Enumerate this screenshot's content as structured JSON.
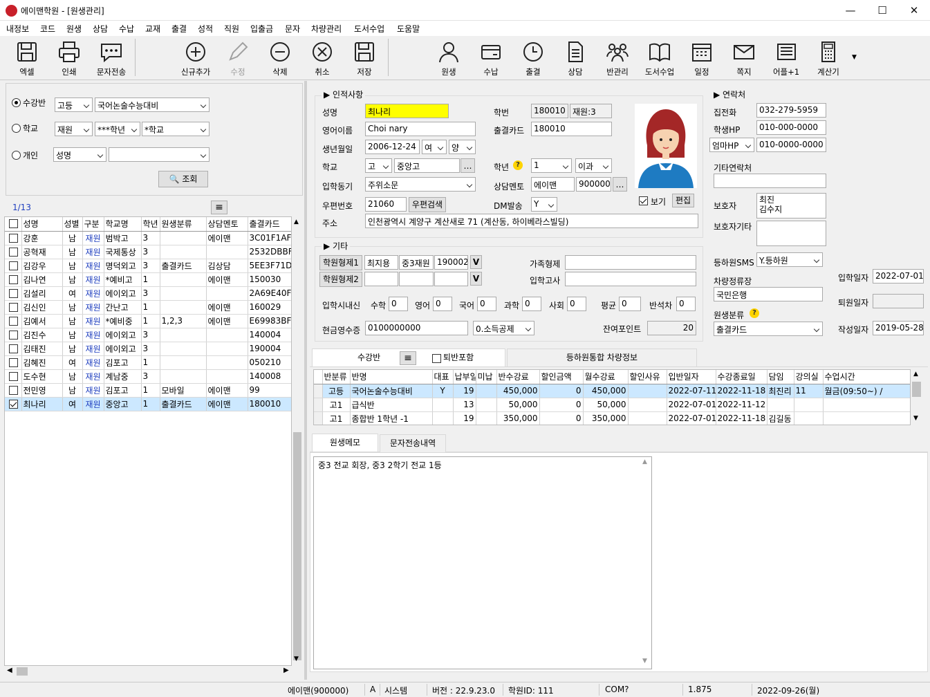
{
  "window": {
    "title": "에이맨학원 - [원생관리]"
  },
  "menu": [
    "내정보",
    "코드",
    "원생",
    "상담",
    "수납",
    "교재",
    "출결",
    "성적",
    "직원",
    "입출금",
    "문자",
    "차량관리",
    "도서수업",
    "도움말"
  ],
  "toolbar": {
    "excel": "엑셀",
    "print": "인쇄",
    "sms": "문자전송",
    "add": "신규추가",
    "edit": "수정",
    "delete": "삭제",
    "cancel": "취소",
    "save": "저장",
    "student": "원생",
    "payment": "수납",
    "attendance": "출결",
    "consult": "상담",
    "class_mgmt": "반관리",
    "book_class": "도서수업",
    "schedule": "일정",
    "note": "쪽지",
    "more": "어플+1",
    "calculator": "계산기"
  },
  "search": {
    "radio_class": "수강반",
    "radio_school": "학교",
    "radio_person": "개인",
    "class_level": "고등",
    "class_name": "국어논술수능대비",
    "school_status": "재원",
    "school_grade": "***학년",
    "school_name": "*학교",
    "person_field": "성명",
    "person_value": "",
    "search_btn": "조회"
  },
  "list": {
    "count": "1/13",
    "headers": [
      "성명",
      "성별",
      "구분",
      "학교명",
      "학년",
      "원생분류",
      "상담멘토",
      "출결카드"
    ],
    "rows": [
      {
        "checked": false,
        "name": "강훈",
        "gender": "남",
        "type": "재원",
        "school": "범박고",
        "grade": "3",
        "category": "",
        "mentor": "에이맨",
        "card": "3C01F1AF"
      },
      {
        "checked": false,
        "name": "공혁재",
        "gender": "남",
        "type": "재원",
        "school": "국제통상",
        "grade": "3",
        "category": "",
        "mentor": "",
        "card": "2532DBBF"
      },
      {
        "checked": false,
        "name": "김강우",
        "gender": "남",
        "type": "재원",
        "school": "명덕외고",
        "grade": "3",
        "category": "출결카드",
        "mentor": "김상담",
        "card": "5EE3F71D"
      },
      {
        "checked": false,
        "name": "김나연",
        "gender": "남",
        "type": "재원",
        "school": "*예비고",
        "grade": "1",
        "category": "",
        "mentor": "에이맨",
        "card": "150030"
      },
      {
        "checked": false,
        "name": "김설리",
        "gender": "여",
        "type": "재원",
        "school": "에이외고",
        "grade": "3",
        "category": "",
        "mentor": "",
        "card": "2A69E40F"
      },
      {
        "checked": false,
        "name": "김신인",
        "gender": "남",
        "type": "재원",
        "school": "간난고",
        "grade": "1",
        "category": "",
        "mentor": "에이맨",
        "card": "160029"
      },
      {
        "checked": false,
        "name": "김예서",
        "gender": "남",
        "type": "재원",
        "school": "*예비중",
        "grade": "1",
        "category": "1,2,3",
        "mentor": "에이맨",
        "card": "E69983BF"
      },
      {
        "checked": false,
        "name": "김진수",
        "gender": "남",
        "type": "재원",
        "school": "에이외고",
        "grade": "3",
        "category": "",
        "mentor": "",
        "card": "140004"
      },
      {
        "checked": false,
        "name": "김태진",
        "gender": "남",
        "type": "재원",
        "school": "에이외고",
        "grade": "3",
        "category": "",
        "mentor": "",
        "card": "190004"
      },
      {
        "checked": false,
        "name": "김혜진",
        "gender": "여",
        "type": "재원",
        "school": "김포고",
        "grade": "1",
        "category": "",
        "mentor": "",
        "card": "050210"
      },
      {
        "checked": false,
        "name": "도수현",
        "gender": "남",
        "type": "재원",
        "school": "계남중",
        "grade": "3",
        "category": "",
        "mentor": "",
        "card": "140008"
      },
      {
        "checked": false,
        "name": "전민영",
        "gender": "남",
        "type": "재원",
        "school": "김포고",
        "grade": "1",
        "category": "모바일",
        "mentor": "에이맨",
        "card": "99"
      },
      {
        "checked": true,
        "name": "최나리",
        "gender": "여",
        "type": "재원",
        "school": "중앙고",
        "grade": "1",
        "category": "출결카드",
        "mentor": "에이맨",
        "card": "180010"
      }
    ]
  },
  "personal": {
    "section": "인적사항",
    "name_label": "성명",
    "name": "최나리",
    "eng_label": "영어이름",
    "eng": "Choi nary",
    "birth_label": "생년월일",
    "birth": "2006-12-24",
    "gender": "여",
    "calendar": "양",
    "school_label": "학교",
    "school_level": "고",
    "school": "중앙고",
    "motive_label": "입학동기",
    "motive": "주위소문",
    "zip_label": "우편번호",
    "zip": "21060",
    "zip_btn": "우편검색",
    "addr_label": "주소",
    "addr": "인천광역시 계양구 계산새로 71 (계산동, 하이베라스빌딩)",
    "id_label": "학번",
    "id": "180010",
    "status": "재원:3",
    "card_label": "출결카드",
    "card": "180010",
    "grade_label": "학년",
    "grade": "1",
    "grade_cmp": "이과",
    "mentor_label": "상담멘토",
    "mentor": "에이맨",
    "mentor_code": "900000",
    "dm_label": "DM발송",
    "dm": "Y",
    "photo_show": "보기",
    "photo_edit": "편집"
  },
  "contact": {
    "section": "연락처",
    "home_label": "집전화",
    "home": "032-279-5959",
    "hp_label": "학생HP",
    "hp": "010-000-0000",
    "parent_hp_type": "엄마HP",
    "parent_hp": "010-0000-0000",
    "other_label": "기타연락처",
    "other": "",
    "guardian_label": "보호자",
    "guardian": "최진\n김수지",
    "guardian_other_label": "보호자기타",
    "guardian_other": ""
  },
  "side": {
    "sms_label": "등하원SMS",
    "sms": "Y.등하원",
    "stop_label": "차량정류장",
    "stop": "국민은행",
    "cat_label": "원생분류",
    "cat": "출결카드",
    "entry_label": "입학일자",
    "entry": "2022-07-01",
    "leave_label": "퇴원일자",
    "leave": "",
    "write_label": "작성일자",
    "write": "2019-05-28"
  },
  "etc": {
    "section": "기타",
    "sib1_btn": "학원형제1",
    "sib1": [
      "최지용",
      "중3재원",
      "190002"
    ],
    "sib2_btn": "학원형제2",
    "sib2": [
      "",
      "",
      ""
    ],
    "family_label": "가족형제",
    "family": "",
    "exam_label": "입학고사",
    "exam": "",
    "score_label": "입학시내신",
    "math_label": "수학",
    "math": "0",
    "eng_label": "영어",
    "eng": "0",
    "kor_label": "국어",
    "kor": "0",
    "sci_label": "과학",
    "sci": "0",
    "soc_label": "사회",
    "soc": "0",
    "avg_label": "평균",
    "avg": "0",
    "rank_label": "반석차",
    "rank": "0",
    "receipt_label": "현금영수증",
    "receipt": "0100000000",
    "receipt_type": "0.소득공제",
    "point_label": "잔여포인트",
    "point": "20"
  },
  "classes": {
    "tab1": "수강반",
    "withdraw": "퇴반포함",
    "tab2": "등하원통합 차량정보",
    "headers": [
      "반분류",
      "반명",
      "대표",
      "납부일",
      "미납",
      "반수강료",
      "할인금액",
      "월수강료",
      "할인사유",
      "입반일자",
      "수강종료일",
      "담임",
      "강의실",
      "수업시간"
    ],
    "rows": [
      [
        "고등",
        "국어논술수능대비",
        "Y",
        "19",
        "",
        "450,000",
        "0",
        "450,000",
        "",
        "2022-07-11",
        "2022-11-18",
        "최진리",
        "11",
        "월금(09:50~) /"
      ],
      [
        "고1",
        "급식반",
        "",
        "13",
        "",
        "50,000",
        "0",
        "50,000",
        "",
        "2022-07-01",
        "2022-11-12",
        "",
        "",
        ""
      ],
      [
        "고1",
        "종합반 1학년 -1",
        "",
        "19",
        "",
        "350,000",
        "0",
        "350,000",
        "",
        "2022-07-01",
        "2022-11-18",
        "김길동",
        "",
        ""
      ]
    ]
  },
  "memo": {
    "tab1": "원생메모",
    "tab2": "문자전송내역",
    "text": "중3 전교 회장, 중3 2학기 전교 1등"
  },
  "statusbar": [
    "에이맨(900000)",
    "A",
    "시스템",
    "버전 : 22.9.23.0",
    "학원ID: 111",
    "COM?",
    "1.875",
    "2022-09-26(월)"
  ]
}
